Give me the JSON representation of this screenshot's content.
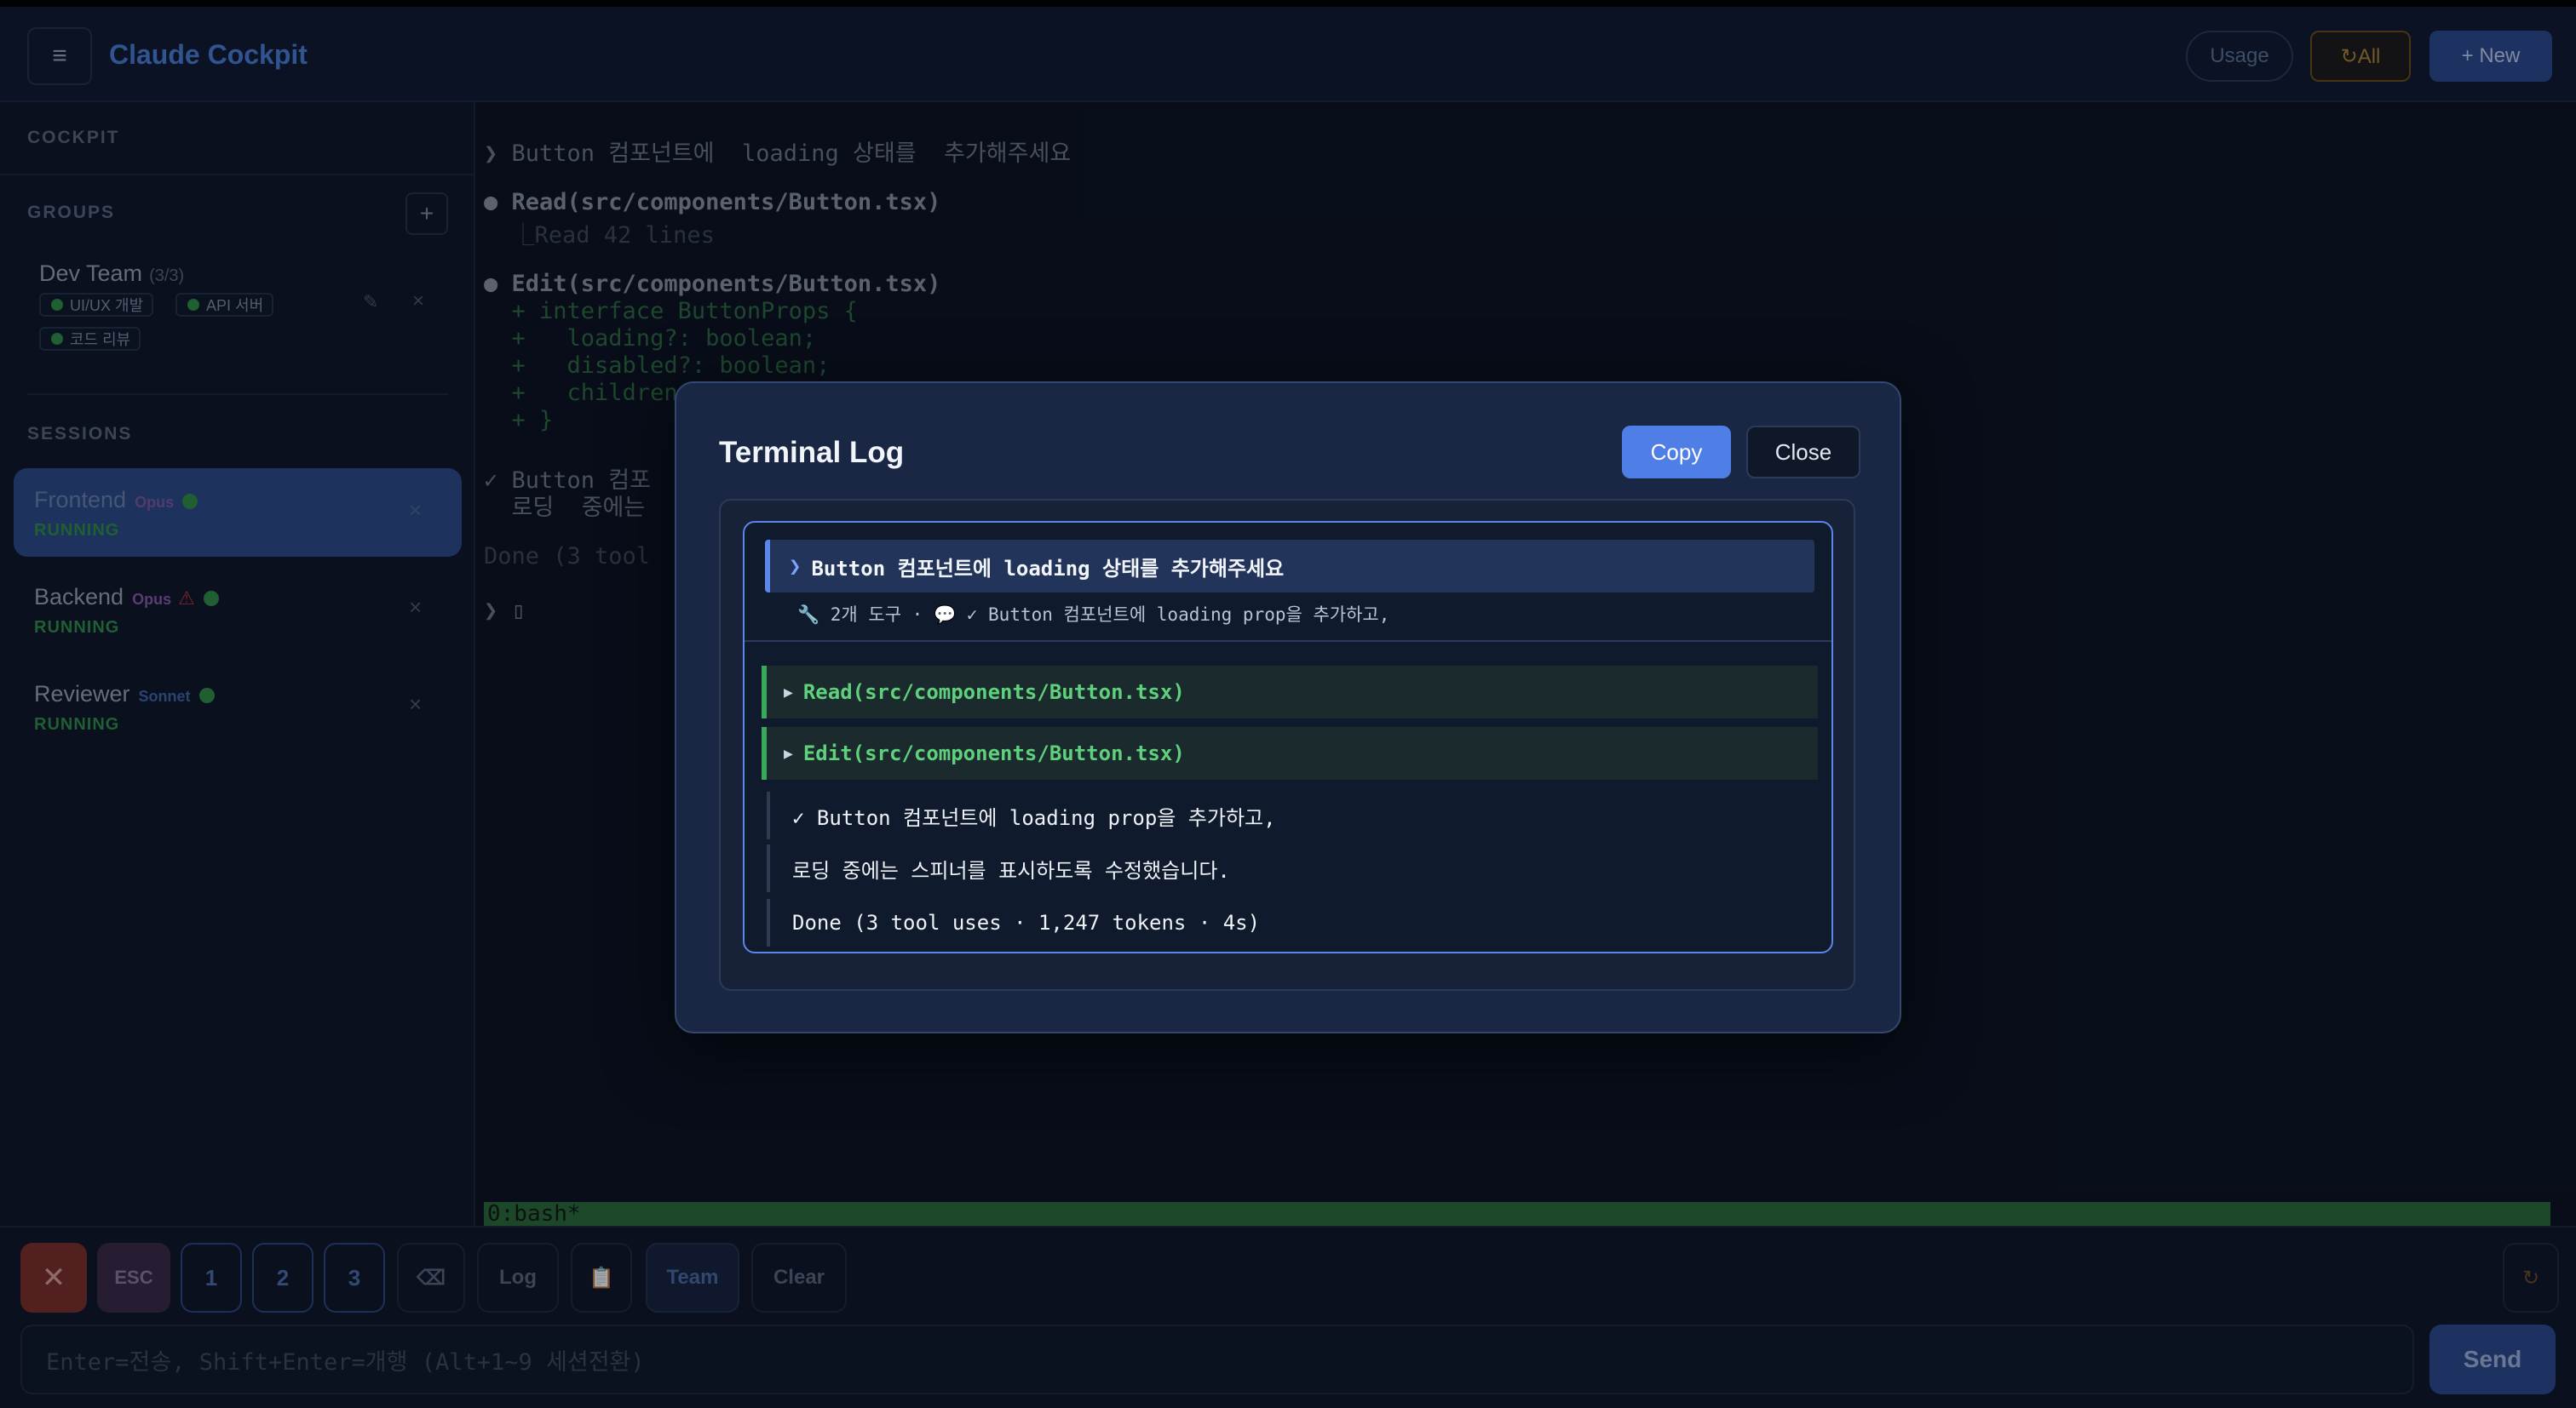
{
  "header": {
    "menu_glyph": "≡",
    "title": "Claude Cockpit",
    "usage_label": "Usage",
    "refresh_all_label": "↻All",
    "new_label": "+ New"
  },
  "sidebar": {
    "cockpit_label": "COCKPIT",
    "groups_label": "GROUPS",
    "add_group_glyph": "+",
    "group": {
      "name": "Dev Team",
      "count": "(3/3)",
      "members": [
        "UI/UX 개발",
        "API 서버",
        "코드 리뷰"
      ],
      "edit_glyph": "✎",
      "close_glyph": "×"
    },
    "sessions_label": "SESSIONS",
    "sessions": [
      {
        "name": "Frontend",
        "model": "Opus",
        "status": "RUNNING",
        "model_color": "#7b5a9e"
      },
      {
        "name": "Backend",
        "model": "Opus",
        "status": "RUNNING",
        "warn": "⚠",
        "model_color": "#8a5aa8"
      },
      {
        "name": "Reviewer",
        "model": "Sonnet",
        "status": "RUNNING",
        "model_color": "#3f64a8"
      }
    ],
    "session_close_glyph": "×"
  },
  "terminal": {
    "lines": [
      "❯ Button 컴포넌트에  loading 상태를  추가해주세요",
      "● Read(src/components/Button.tsx)",
      "  ⎿Read 42 lines",
      "● Edit(src/components/Button.tsx)",
      "  + interface ButtonProps {",
      "  +   loading?: boolean;",
      "  +   disabled?: boolean;",
      "  +   children",
      "  + }",
      "✓ Button 컴포",
      "  로딩  중에는",
      "Done (3 tool",
      "❯ ▯"
    ],
    "status_bar": "0:bash*"
  },
  "bottom": {
    "stop_glyph": "✕",
    "esc_label": "ESC",
    "num_labels": [
      "1",
      "2",
      "3"
    ],
    "backspace_glyph": "⌫",
    "log_label": "Log",
    "clipboard_glyph": "📋",
    "team_label": "Team",
    "clear_label": "Clear",
    "refresh_glyph": "↻",
    "input_placeholder": "Enter=전송, Shift+Enter=개행 (Alt+1~9 세션전환)",
    "send_label": "Send"
  },
  "modal": {
    "title": "Terminal Log",
    "copy_label": "Copy",
    "close_label": "Close",
    "prompt": "Button 컴포넌트에 loading 상태를 추가해주세요",
    "summary": "🔧 2개 도구 · 💬 ✓ Button 컴포넌트에 loading prop을 추가하고,",
    "tools": [
      "Read(src/components/Button.tsx)",
      "Edit(src/components/Button.tsx)"
    ],
    "response_lines": [
      "✓ Button 컴포넌트에 loading prop을 추가하고,",
      "로딩 중에는 스피너를 표시하도록 수정했습니다.",
      "Done (3 tool uses · 1,247 tokens · 4s)"
    ]
  }
}
